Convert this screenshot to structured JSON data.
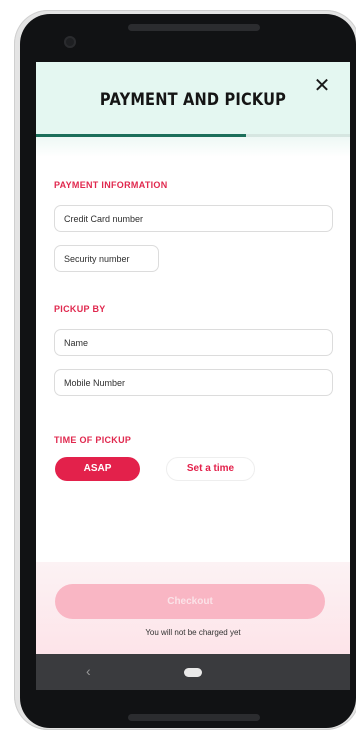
{
  "header": {
    "title": "PAYMENT AND PICKUP",
    "close_label": "✕"
  },
  "progress": {
    "fraction": 0.67
  },
  "payment": {
    "section_label": "PAYMENT INFORMATION",
    "card_placeholder": "Credit Card number",
    "security_placeholder": "Security number"
  },
  "pickup": {
    "section_label": "PICKUP BY",
    "name_placeholder": "Name",
    "mobile_placeholder": "Mobile Number"
  },
  "time": {
    "section_label": "TIME OF PICKUP",
    "asap_label": "ASAP",
    "set_time_label": "Set a time"
  },
  "footer": {
    "checkout_label": "Checkout",
    "note": "You will not be charged yet"
  },
  "navbar": {
    "back_label": "‹"
  },
  "colors": {
    "accent": "#e3214b",
    "header_bg": "#e4f7f1",
    "progress": "#1b6f5a"
  }
}
